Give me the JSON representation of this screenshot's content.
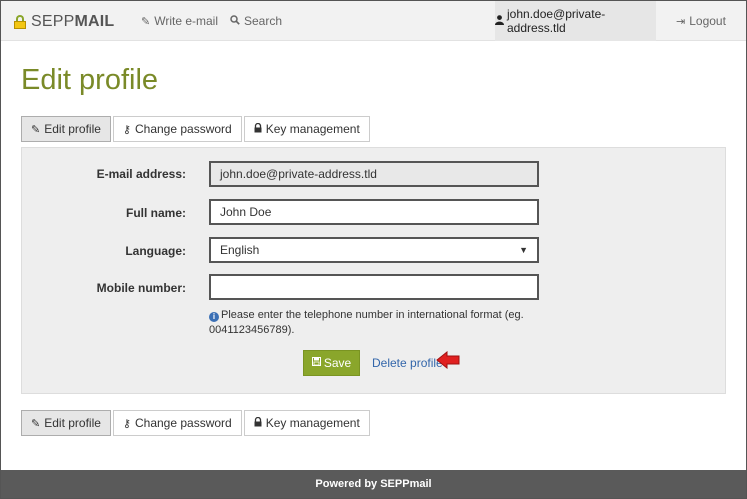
{
  "brand": {
    "name_light": "SEPP",
    "name_bold": "MAIL"
  },
  "nav": {
    "write_email": "Write e-mail",
    "search": "Search",
    "user": "john.doe@private-address.tld",
    "logout": "Logout"
  },
  "page": {
    "title": "Edit profile"
  },
  "tabs": [
    {
      "label": "Edit profile",
      "icon": "pencil-icon"
    },
    {
      "label": "Change password",
      "icon": "key-icon"
    },
    {
      "label": "Key management",
      "icon": "lock-icon"
    }
  ],
  "form": {
    "email": {
      "label": "E-mail address:",
      "value": "john.doe@private-address.tld"
    },
    "fullname": {
      "label": "Full name:",
      "value": "John Doe"
    },
    "language": {
      "label": "Language:",
      "value": "English"
    },
    "mobile": {
      "label": "Mobile number:",
      "value": ""
    },
    "help_text": "Please enter the telephone number in international format (eg. 0041123456789).",
    "save_label": "Save",
    "delete_label": "Delete profile"
  },
  "footer": {
    "text": "Powered by SEPPmail"
  },
  "colors": {
    "accent": "#8aa62b",
    "title": "#7a8a28",
    "link": "#3366aa",
    "arrow": "#e02020"
  }
}
